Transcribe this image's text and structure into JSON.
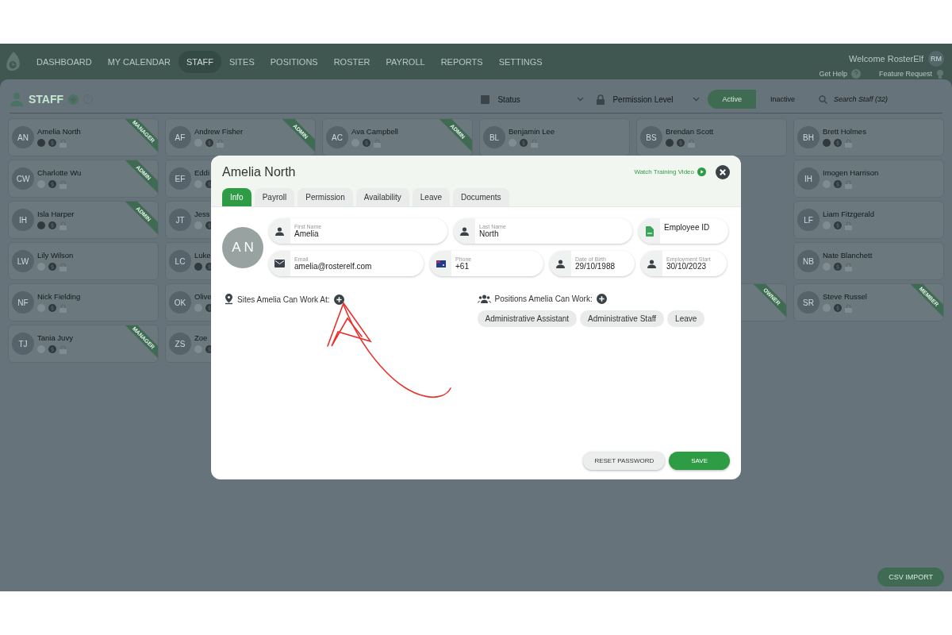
{
  "nav": {
    "items": [
      {
        "label": "DASHBOARD",
        "selected": false
      },
      {
        "label": "MY CALENDAR",
        "selected": false
      },
      {
        "label": "STAFF",
        "selected": true
      },
      {
        "label": "SITES",
        "selected": false
      },
      {
        "label": "POSITIONS",
        "selected": false
      },
      {
        "label": "ROSTER",
        "selected": false
      },
      {
        "label": "PAYROLL",
        "selected": false
      },
      {
        "label": "REPORTS",
        "selected": false
      },
      {
        "label": "SETTINGS",
        "selected": false
      }
    ],
    "welcome": "Welcome RosterElf",
    "user_initials": "RM",
    "help": "Get Help",
    "feature": "Feature Request"
  },
  "toolbar": {
    "title": "STAFF",
    "filters": [
      "Status",
      "Permission Level"
    ],
    "status_toggle": [
      {
        "label": "Active",
        "selected": true
      },
      {
        "label": "Inactive",
        "selected": false
      }
    ],
    "search": {
      "placeholder": "Search Staff (32)"
    }
  },
  "staff_rows": [
    [
      {
        "initials": "AN",
        "name": "Amelia North",
        "badge_active": true,
        "role": "MANAGER"
      },
      {
        "initials": "AF",
        "name": "Andrew Fisher",
        "badge_active": false,
        "role": "ADMIN"
      },
      {
        "initials": "AC",
        "name": "Ava Campbell",
        "badge_active": false,
        "role": "ADMIN"
      },
      {
        "initials": "BL",
        "name": "Benjamin Lee",
        "badge_active": false
      },
      {
        "initials": "BS",
        "name": "Brendan Scott",
        "badge_active": true
      },
      {
        "initials": "BH",
        "name": "Brett Holmes",
        "badge_active": true
      }
    ],
    [
      {
        "initials": "CW",
        "name": "Charlotte Wu",
        "badge_active": false,
        "role": "ADMIN"
      },
      {
        "initials": "EF",
        "name": "Eddi",
        "badge_active": false
      },
      null,
      null,
      null,
      {
        "initials": "IH",
        "name": "Imogen Harrison",
        "badge_active": false
      }
    ],
    [
      {
        "initials": "IH",
        "name": "Isla Harper",
        "badge_active": true,
        "role": "ADMIN"
      },
      {
        "initials": "JT",
        "name": "Jess",
        "badge_active": false
      },
      null,
      null,
      null,
      {
        "initials": "LF",
        "name": "Liam Fitzgerald",
        "badge_active": false
      }
    ],
    [
      {
        "initials": "LW",
        "name": "Lily Wilson",
        "badge_active": false
      },
      {
        "initials": "LC",
        "name": "Luke",
        "badge_active": true
      },
      null,
      null,
      null,
      {
        "initials": "NB",
        "name": "Nate Blanchett",
        "badge_active": false
      }
    ],
    [
      {
        "initials": "NF",
        "name": "Nick Fielding",
        "badge_active": false
      },
      {
        "initials": "OK",
        "name": "Olive",
        "badge_active": false
      },
      null,
      null,
      {
        "role": "OWNER"
      },
      {
        "initials": "SR",
        "name": "Steve Russel",
        "badge_active": false,
        "role": "MEMBER"
      }
    ],
    [
      {
        "initials": "TJ",
        "name": "Tania Juvy",
        "badge_active": false,
        "role": "MANAGER"
      },
      {
        "initials": "ZS",
        "name": "Zoe",
        "badge_active": false
      }
    ]
  ],
  "modal": {
    "title": "Amelia North",
    "training_link": "Watch Training Video",
    "initials": "A N",
    "tabs": [
      {
        "label": "Info",
        "selected": true
      },
      {
        "label": "Payroll",
        "selected": false
      },
      {
        "label": "Permission",
        "selected": false
      },
      {
        "label": "Availability",
        "selected": false
      },
      {
        "label": "Leave",
        "selected": false
      },
      {
        "label": "Documents",
        "selected": false
      }
    ],
    "fields_row_1": [
      {
        "kind": "person",
        "label": "First Name",
        "value": "Amelia"
      },
      {
        "kind": "person",
        "label": "Last Name",
        "value": "North"
      },
      {
        "kind": "document",
        "placeholder": "Employee ID"
      }
    ],
    "fields_row_2": [
      {
        "kind": "email",
        "label": "Email",
        "value": "amelia@rosterelf.com"
      },
      {
        "kind": "flag",
        "label": "Phone",
        "value": "+61"
      },
      {
        "kind": "person",
        "label": "Date of Birth",
        "value": "29/10/1988"
      },
      {
        "kind": "person",
        "label": "Employment Start",
        "value": "30/10/2023"
      }
    ],
    "sites": {
      "label": "Sites Amelia Can Work At:"
    },
    "positions": {
      "label": "Positions Amelia Can Work:",
      "chips": [
        "Administrative Assistant",
        "Administrative Staff",
        "Leave"
      ]
    },
    "buttons": {
      "reset": "RESET PASSWORD",
      "save": "SAVE"
    }
  },
  "csv_button": "CSV IMPORT"
}
